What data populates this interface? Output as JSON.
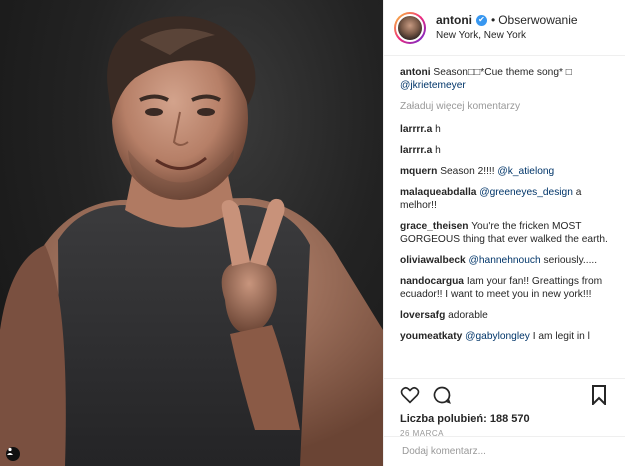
{
  "header": {
    "username": "antoni",
    "separator": "•",
    "follow_label": "Obserwowanie",
    "location": "New York, New York"
  },
  "caption": {
    "username": "antoni",
    "text": "Season□□*Cue theme song* □",
    "mention": "@jkrietemeyer"
  },
  "load_more_label": "Załaduj więcej komentarzy",
  "comments": [
    {
      "username": "larrrr.a",
      "text": "h",
      "mention": ""
    },
    {
      "username": "larrrr.a",
      "text": "h",
      "mention": ""
    },
    {
      "username": "mquern",
      "text": "Season 2!!!!",
      "mention": "@k_atielong"
    },
    {
      "username": "malaqueabdalla",
      "text": "",
      "mention": "@greeneyes_design",
      "after": "a melhor!!"
    },
    {
      "username": "grace_theisen",
      "text": "You're the fricken MOST GORGEOUS thing that ever walked the earth.",
      "mention": ""
    },
    {
      "username": "oliviawalbeck",
      "text": "",
      "mention": "@hannehnouch",
      "after": "seriously....."
    },
    {
      "username": "nandocargua",
      "text": "Iam your fan!! Greattings from ecuador!! I want to meet you in new york!!!",
      "mention": ""
    },
    {
      "username": "loversafg",
      "text": "adorable",
      "mention": ""
    },
    {
      "username": "youmeatkaty",
      "text": "",
      "mention": "@gabylongley",
      "after": "I am legit in l"
    }
  ],
  "icons": {
    "like": "heart-icon",
    "comment": "comment-icon",
    "save": "bookmark-icon",
    "verified": "verified-badge-icon",
    "user_tag": "user-tag-icon"
  },
  "likes_text": "Liczba polubień: 188 570",
  "date": "26 MARCA",
  "add_comment_placeholder": "Dodaj komentarz...",
  "colors": {
    "link": "#003569",
    "verified": "#3897f0",
    "muted": "#999999",
    "text": "#262626"
  }
}
